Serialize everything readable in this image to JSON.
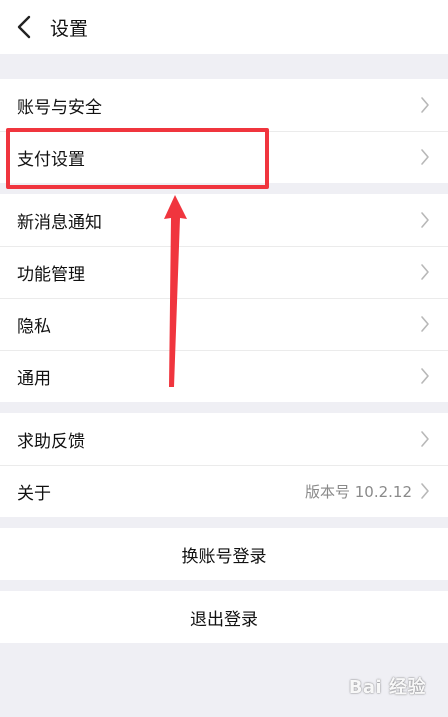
{
  "header": {
    "title": "设置",
    "back_icon": "chevron-left-icon"
  },
  "groups": [
    {
      "items": [
        {
          "label": "账号与安全",
          "value": ""
        },
        {
          "label": "支付设置",
          "value": ""
        }
      ]
    },
    {
      "items": [
        {
          "label": "新消息通知",
          "value": ""
        },
        {
          "label": "功能管理",
          "value": ""
        },
        {
          "label": "隐私",
          "value": ""
        },
        {
          "label": "通用",
          "value": ""
        }
      ]
    },
    {
      "items": [
        {
          "label": "求助反馈",
          "value": ""
        },
        {
          "label": "关于",
          "value": "版本号 10.2.12"
        }
      ]
    }
  ],
  "actions": {
    "switch_account": "换账号登录",
    "logout": "退出登录"
  },
  "annotation": {
    "color": "#f0353e"
  },
  "watermark": {
    "text": "Bai 经验"
  }
}
